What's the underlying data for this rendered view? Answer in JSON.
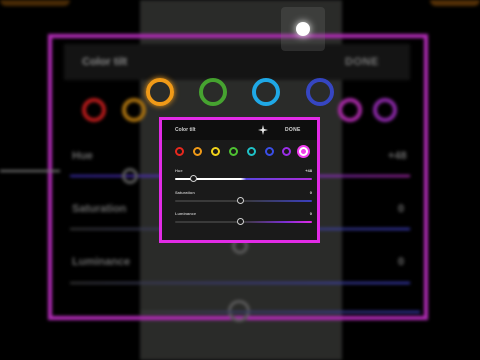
{
  "panel": {
    "title": "Color tilt",
    "done_label": "DONE",
    "eyedropper_icon": "crosshair-icon",
    "swatches": [
      {
        "name": "red",
        "color": "#e8281e"
      },
      {
        "name": "orange",
        "color": "#f09a18"
      },
      {
        "name": "yellow",
        "color": "#f2d31a"
      },
      {
        "name": "green",
        "color": "#4ec232"
      },
      {
        "name": "cyan",
        "color": "#1fc2c8"
      },
      {
        "name": "blue",
        "color": "#3a4ee8"
      },
      {
        "name": "purple",
        "color": "#9a2ee6"
      },
      {
        "name": "magenta",
        "color": "#f040e8"
      }
    ],
    "selected_swatch": "magenta",
    "sliders": [
      {
        "id": "hue",
        "label": "Hue",
        "value": "+48",
        "level": 0.15
      },
      {
        "id": "saturation",
        "label": "Saturation",
        "value": "0",
        "level": 0.5
      },
      {
        "id": "luminance",
        "label": "Luminance",
        "value": "0",
        "level": 0.5
      }
    ]
  },
  "background": {
    "title": "Color tilt",
    "done_label": "DONE",
    "hue_label": "Hue",
    "hue_value": "+48",
    "saturation_label": "Saturation",
    "saturation_value": "0",
    "luminance_label": "Luminance",
    "luminance_value": "0"
  },
  "colors": {
    "frame": "#e22be6",
    "panel_bg": "#1a1a1a",
    "accent_ring_orange": "#f09a18",
    "accent_ring_green": "#4ec232",
    "accent_ring_cyan": "#1fa8e6",
    "accent_ring_blue": "#3a4ee8"
  }
}
